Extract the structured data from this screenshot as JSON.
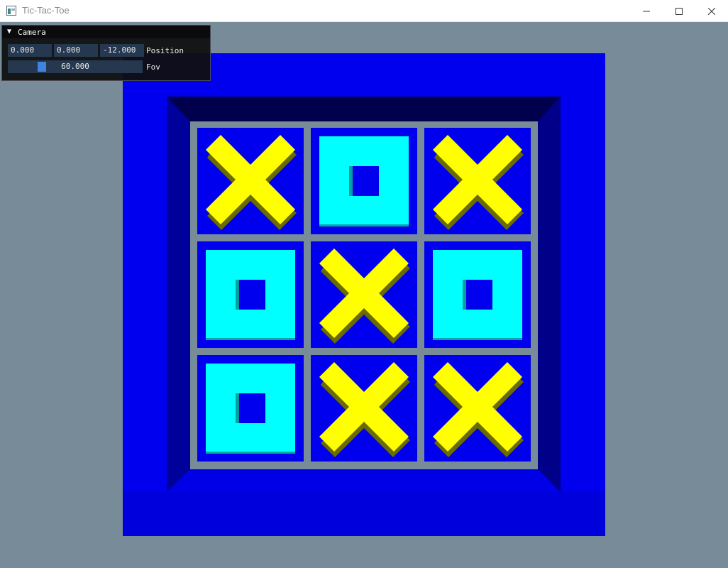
{
  "window": {
    "title": "Tic-Tac-Toe",
    "app_icon": "app-window-icon",
    "controls": {
      "minimize": "minimize-icon",
      "maximize": "maximize-icon",
      "close": "close-icon"
    }
  },
  "camera_panel": {
    "title": "Camera",
    "collapse_icon": "triangle-down-icon",
    "position": {
      "x": "0.000",
      "y": "0.000",
      "z": "-12.000",
      "label": "Position"
    },
    "fov": {
      "value": "60.000",
      "label": "Fov",
      "fraction": 0.23
    }
  },
  "board": {
    "cells": [
      "X",
      "O",
      "X",
      "O",
      "X",
      "O",
      "O",
      "X",
      "X"
    ]
  },
  "colors": {
    "background": "#778b99",
    "frame": "#0000ee",
    "cell": "#0000ee",
    "x_piece": "#ffff00",
    "o_piece": "#00ffff",
    "grid": "#778b99"
  }
}
